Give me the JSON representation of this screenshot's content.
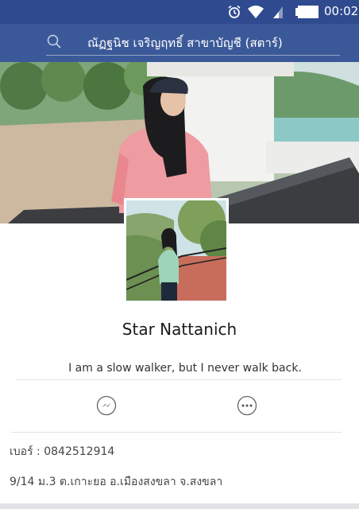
{
  "status_bar": {
    "time": "00:02",
    "icons": [
      "alarm-icon",
      "wifi-icon",
      "signal-icon",
      "battery-icon"
    ],
    "color": "#2f4a8e"
  },
  "header": {
    "search_text": "ณัฏฐนิช เจริญฤทธิ์  สาขาบัญชี  (สตาร์)",
    "icon": "search-icon",
    "color": "#3b5998"
  },
  "profile": {
    "name": "Star Nattanich",
    "bio": "I am a slow walker, but I never walk back.",
    "actions": [
      {
        "name": "messenger",
        "icon": "messenger-icon"
      },
      {
        "name": "more",
        "icon": "more-icon"
      }
    ],
    "phone": "เบอร์ : 0842512914",
    "address": "9/14 ม.3 ต.เกาะยอ อ.เมืองสงขลา จ.สงขลา"
  }
}
